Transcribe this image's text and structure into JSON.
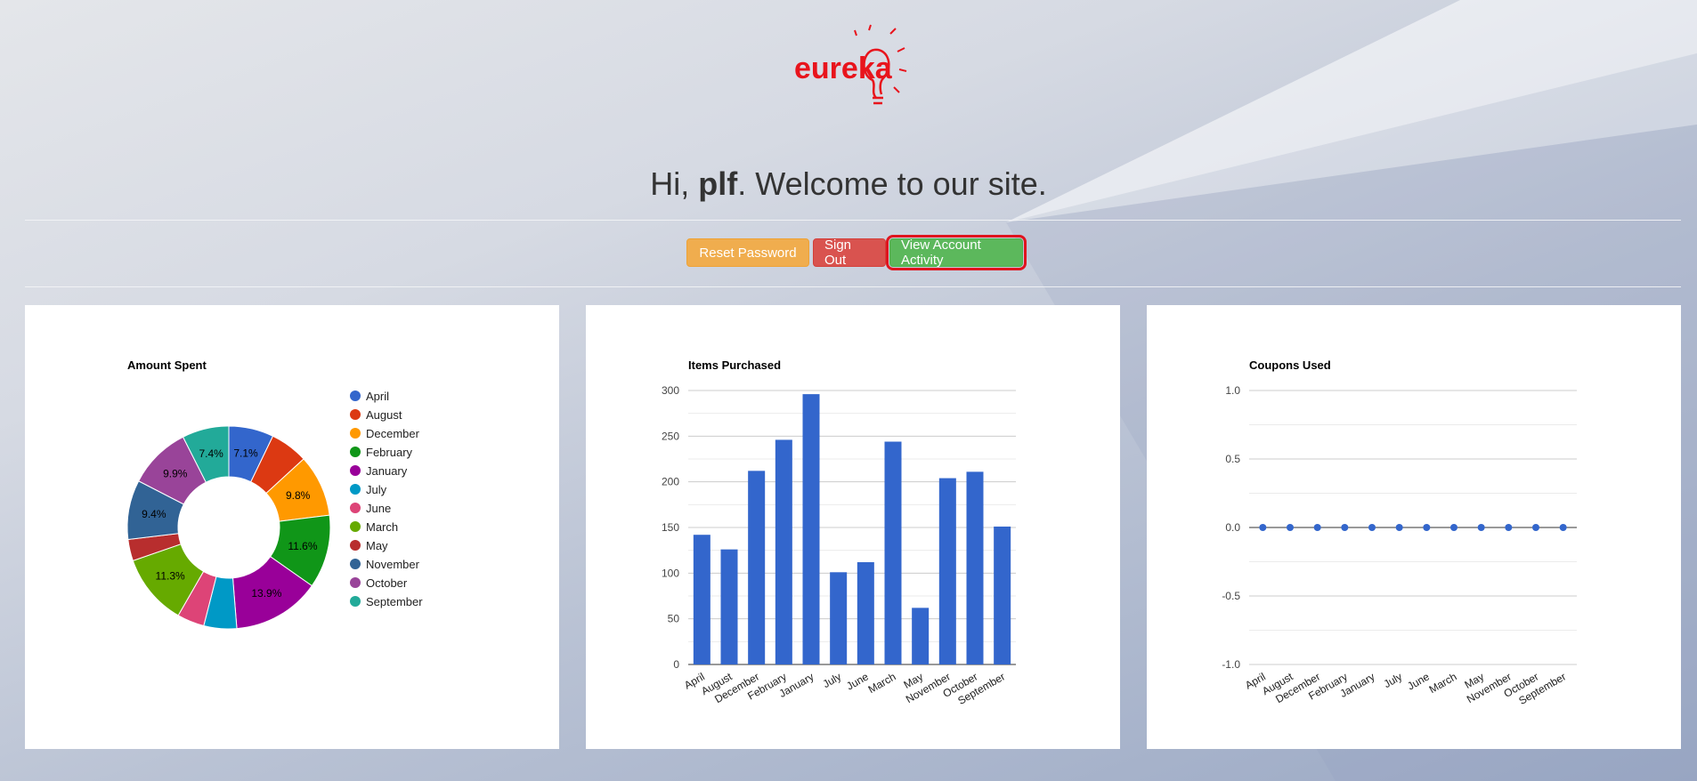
{
  "header": {
    "logo_text": "eureka",
    "greeting_prefix": "Hi, ",
    "username": "plf",
    "greeting_suffix": ". Welcome to our site."
  },
  "actions": {
    "reset_password": "Reset Password",
    "sign_out": "Sign Out",
    "view_activity": "View Account Activity"
  },
  "colors": {
    "primary_bar": "#3366cc",
    "warning": "#f0ad4e",
    "danger": "#d9534f",
    "success": "#5cb85c",
    "logo": "#e8141c"
  },
  "chart_data": [
    {
      "type": "pie",
      "donut": true,
      "title": "Amount Spent",
      "legend_position": "right",
      "categories": [
        "April",
        "August",
        "December",
        "February",
        "January",
        "July",
        "June",
        "March",
        "May",
        "November",
        "October",
        "September"
      ],
      "values": [
        7.1,
        6.0,
        9.8,
        11.6,
        13.9,
        5.2,
        4.3,
        11.3,
        3.4,
        9.4,
        9.9,
        7.4
      ],
      "labels": [
        "7.1%",
        "",
        "9.8%",
        "11.6%",
        "13.9%",
        "",
        "",
        "11.3%",
        "",
        "9.4%",
        "9.9%",
        "7.4%"
      ],
      "colors": [
        "#3366cc",
        "#dc3912",
        "#ff9900",
        "#109618",
        "#990099",
        "#0099c6",
        "#dd4477",
        "#66aa00",
        "#b82e2e",
        "#316395",
        "#994499",
        "#22aa99"
      ]
    },
    {
      "type": "bar",
      "title": "Items Purchased",
      "categories": [
        "April",
        "August",
        "December",
        "February",
        "January",
        "July",
        "June",
        "March",
        "May",
        "November",
        "October",
        "September"
      ],
      "values": [
        142,
        126,
        212,
        246,
        296,
        101,
        112,
        244,
        62,
        204,
        211,
        151
      ],
      "ylim": [
        0,
        300
      ],
      "yticks": [
        0,
        50,
        100,
        150,
        200,
        250,
        300
      ],
      "grid": true
    },
    {
      "type": "line",
      "markers": true,
      "title": "Coupons Used",
      "categories": [
        "April",
        "August",
        "December",
        "February",
        "January",
        "July",
        "June",
        "March",
        "May",
        "November",
        "October",
        "September"
      ],
      "values": [
        0,
        0,
        0,
        0,
        0,
        0,
        0,
        0,
        0,
        0,
        0,
        0
      ],
      "ylim": [
        -1.0,
        1.0
      ],
      "yticks": [
        "1.0",
        "0.5",
        "0.0",
        "-0.5",
        "-1.0"
      ],
      "grid": true
    }
  ]
}
